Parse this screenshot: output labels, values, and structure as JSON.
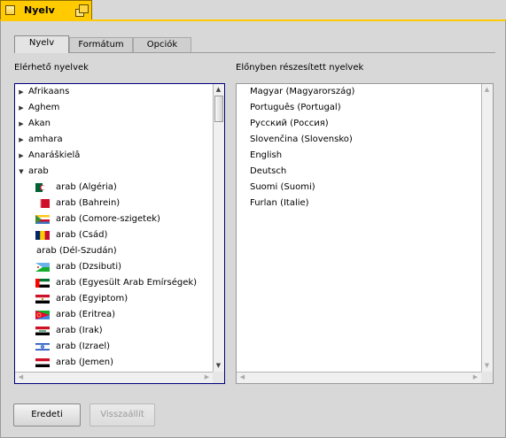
{
  "window": {
    "title": "Nyelv",
    "title_color": "#ffcb00"
  },
  "tabs": [
    {
      "label": "Nyelv",
      "active": true
    },
    {
      "label": "Formátum",
      "active": false
    },
    {
      "label": "Opciók",
      "active": false
    }
  ],
  "available": {
    "heading": "Elérhető nyelvek",
    "items": [
      {
        "label": "Afrikaans",
        "type": "collapsed"
      },
      {
        "label": "Aghem",
        "type": "collapsed"
      },
      {
        "label": "Akan",
        "type": "collapsed"
      },
      {
        "label": "amhara",
        "type": "collapsed"
      },
      {
        "label": "Anaráškielâ",
        "type": "collapsed"
      },
      {
        "label": "arab",
        "type": "expanded"
      },
      {
        "label": "arab (Algéria)",
        "type": "child",
        "flag": "algeria-flag-icon"
      },
      {
        "label": "arab (Bahrein)",
        "type": "child",
        "flag": "bahrain-flag-icon"
      },
      {
        "label": "arab (Comore-szigetek)",
        "type": "child",
        "flag": "comoros-flag-icon"
      },
      {
        "label": "arab (Csád)",
        "type": "child",
        "flag": "chad-flag-icon"
      },
      {
        "label": "arab (Dél-Szudán)",
        "type": "child-noflag"
      },
      {
        "label": "arab (Dzsibuti)",
        "type": "child",
        "flag": "djibouti-flag-icon"
      },
      {
        "label": "arab (Egyesült Arab Emírségek)",
        "type": "child",
        "flag": "uae-flag-icon"
      },
      {
        "label": "arab (Egyiptom)",
        "type": "child",
        "flag": "egypt-flag-icon"
      },
      {
        "label": "arab (Eritrea)",
        "type": "child",
        "flag": "eritrea-flag-icon"
      },
      {
        "label": "arab (Irak)",
        "type": "child",
        "flag": "iraq-flag-icon"
      },
      {
        "label": "arab (Izrael)",
        "type": "child",
        "flag": "israel-flag-icon"
      },
      {
        "label": "arab (Jemen)",
        "type": "child",
        "flag": "yemen-flag-icon"
      }
    ]
  },
  "preferred": {
    "heading": "Előnyben részesített nyelvek",
    "items": [
      "Magyar (Magyarország)",
      "Português (Portugal)",
      "Русский (Россия)",
      "Slovenčina (Slovensko)",
      "English",
      "Deutsch",
      "Suomi (Suomi)",
      "Furlan (Italie)"
    ]
  },
  "buttons": {
    "defaults": "Eredeti",
    "revert": "Visszaállít"
  }
}
